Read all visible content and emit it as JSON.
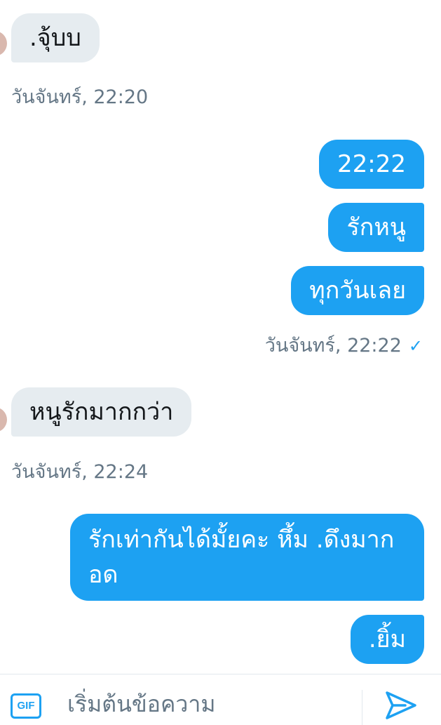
{
  "conversation": {
    "messages": [
      {
        "text": ".จุ้บบ"
      },
      {
        "text": "22:22"
      },
      {
        "text": "รักหนู"
      },
      {
        "text": "ทุกวันเลย"
      },
      {
        "text": "หนูรักมากกว่า"
      },
      {
        "text": "รักเท่ากันได้มั้ยคะ หึ้ม .ดึงมากอด"
      },
      {
        "text": ".ยิ้ม"
      }
    ],
    "timestamps": [
      {
        "text": "วันจันทร์, 22:20"
      },
      {
        "text": "วันจันทร์, 22:22"
      },
      {
        "text": "วันจันทร์, 22:24"
      }
    ],
    "read_mark": "✓"
  },
  "composer": {
    "gif_label": "GIF",
    "placeholder": "เริ่มต้นข้อความ",
    "send_icon": "send-icon"
  },
  "colors": {
    "accent": "#1da1f2",
    "incoming_bubble": "#e6ecf0",
    "timestamp": "#657786"
  }
}
